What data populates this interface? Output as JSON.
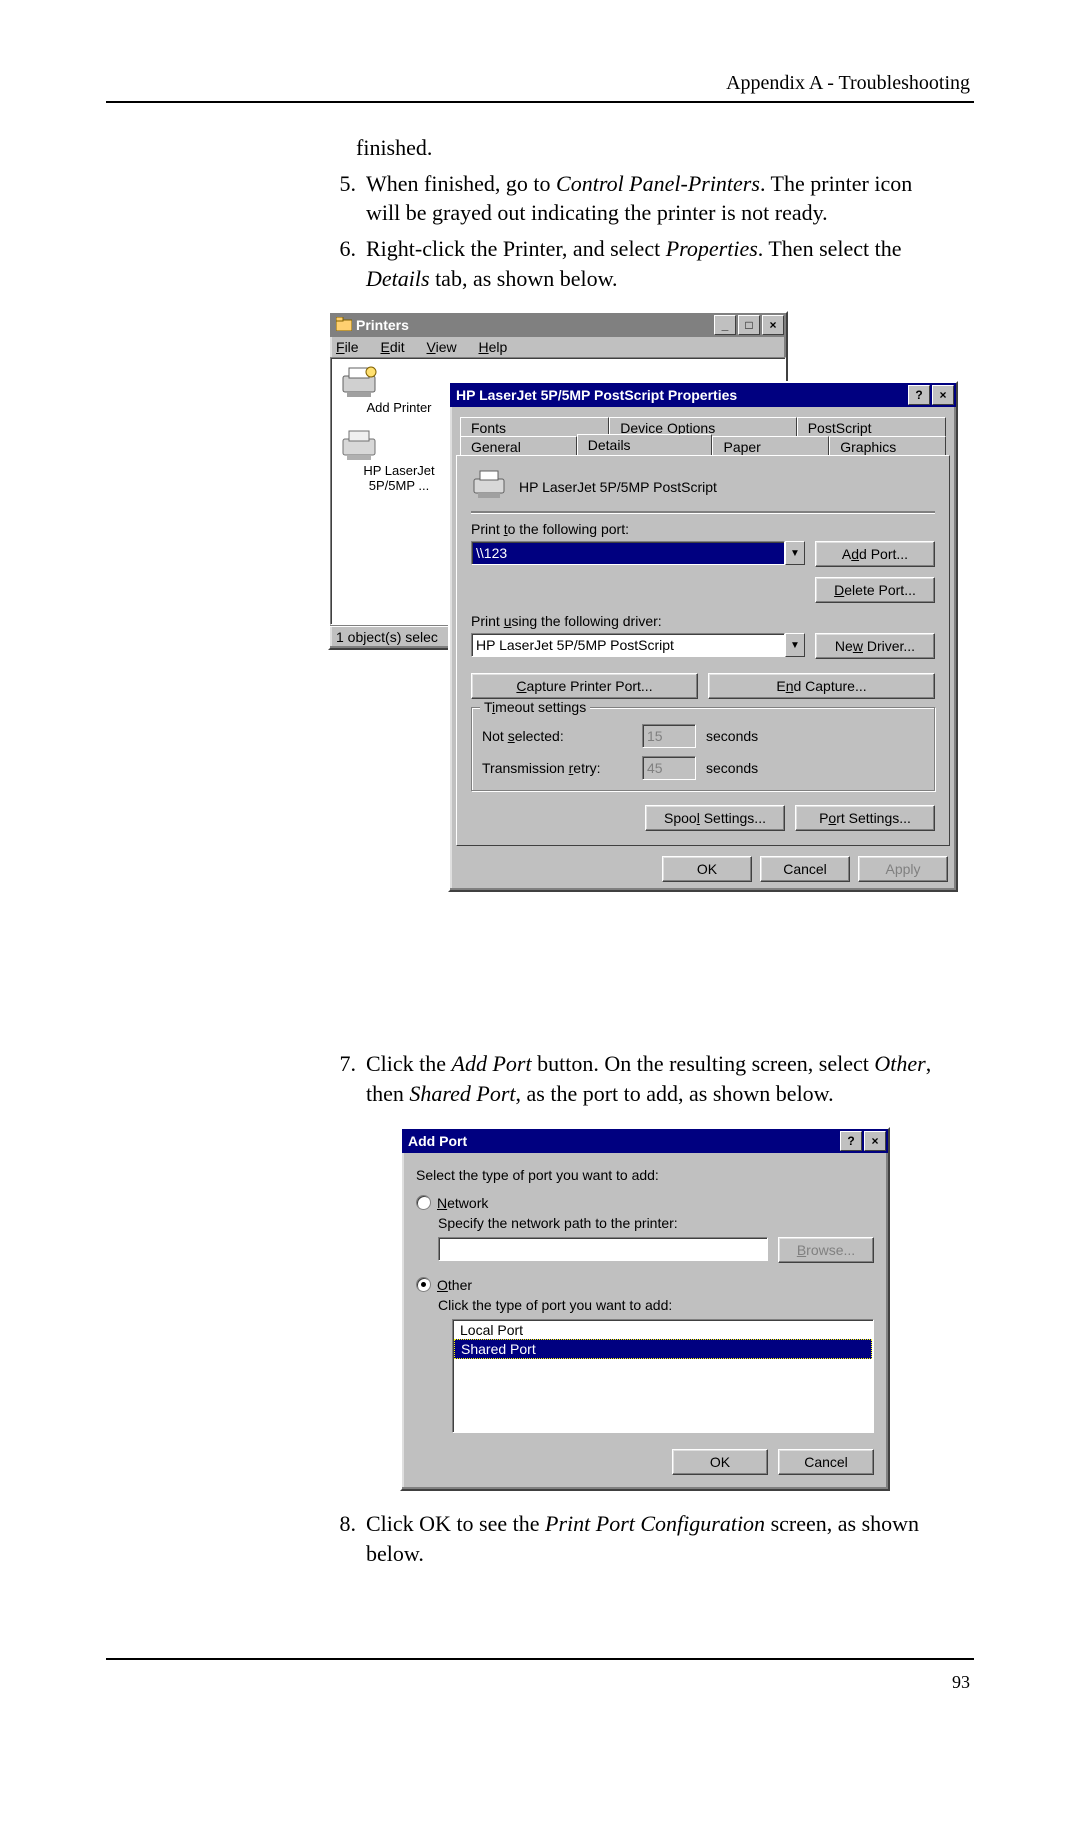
{
  "header": {
    "running": "Appendix A - Troubleshooting"
  },
  "body": {
    "line_finished": "finished.",
    "step5_num": "5.",
    "step5_a": "When finished, go to ",
    "step5_i": "Control Panel-Printers",
    "step5_b": ". The printer icon will be grayed out indicating the printer is not ready.",
    "step6_num": "6.",
    "step6_a": "Right-click the Printer, and select ",
    "step6_i1": "Properties",
    "step6_b": ". Then select the ",
    "step6_i2": "Details",
    "step6_c": " tab, as shown below.",
    "step7_num": "7.",
    "step7_a": "Click the ",
    "step7_i1": "Add Port",
    "step7_b": " button. On the resulting screen, select ",
    "step7_i2": "Other",
    "step7_c": ", then ",
    "step7_i3": "Shared Port",
    "step7_d": ", as the port to add, as shown below.",
    "step8_num": "8.",
    "step8_a": "Click OK to see the ",
    "step8_i": "Print Port Configuration",
    "step8_b": " screen, as shown below."
  },
  "printers_window": {
    "title": "Printers",
    "controls": {
      "min": "_",
      "max": "□",
      "close": "×"
    },
    "menu": {
      "file": "File",
      "edit": "Edit",
      "view": "View",
      "help": "Help"
    },
    "icons": {
      "add": "Add Printer",
      "hp": "HP LaserJet 5P/5MP ..."
    },
    "status": "1 object(s) selec"
  },
  "props": {
    "title": "HP LaserJet 5P/5MP PostScript Properties",
    "controls": {
      "help": "?",
      "close": "×"
    },
    "tabs_back": [
      "Fonts",
      "Device Options",
      "PostScript"
    ],
    "tabs_front": [
      "General",
      "Details",
      "Paper",
      "Graphics"
    ],
    "printer_name": "HP LaserJet 5P/5MP PostScript",
    "port_label": "Print to the following port:",
    "port_value": "\\\\123",
    "driver_label": "Print using the following driver:",
    "driver_value": "HP LaserJet 5P/5MP PostScript",
    "buttons": {
      "add_port": "Add Port...",
      "delete_port": "Delete Port...",
      "new_driver": "New Driver...",
      "capture": "Capture Printer Port...",
      "end_capture": "End Capture...",
      "spool": "Spool Settings...",
      "port_settings": "Port Settings...",
      "ok": "OK",
      "cancel": "Cancel",
      "apply": "Apply"
    },
    "timeout": {
      "legend": "Timeout settings",
      "not_selected": "Not selected:",
      "not_selected_val": "15",
      "retry": "Transmission retry:",
      "retry_val": "45",
      "seconds": "seconds"
    }
  },
  "addport": {
    "title": "Add Port",
    "controls": {
      "help": "?",
      "close": "×"
    },
    "prompt": "Select the type of port you want to add:",
    "network_label": "Network",
    "network_hint": "Specify the network path to the printer:",
    "browse": "Browse...",
    "other_label": "Other",
    "other_hint": "Click the type of port you want to add:",
    "list": {
      "local": "Local Port",
      "shared": "Shared Port"
    },
    "ok": "OK",
    "cancel": "Cancel"
  },
  "page_number": "93"
}
